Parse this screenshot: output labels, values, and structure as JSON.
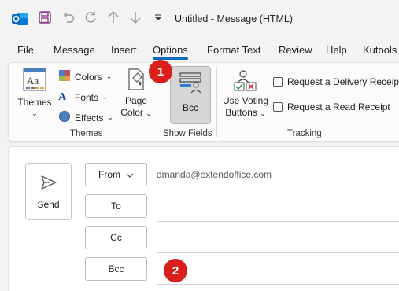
{
  "window": {
    "title": "Untitled  -  Message (HTML)"
  },
  "quick_access": [
    "outlook-app-icon",
    "save-icon",
    "undo-icon",
    "redo-icon",
    "arrow-up-icon",
    "arrow-down-icon",
    "customize-qat-icon"
  ],
  "tabs": [
    {
      "label": "File"
    },
    {
      "label": "Message"
    },
    {
      "label": "Insert"
    },
    {
      "label": "Options",
      "active": true
    },
    {
      "label": "Format Text"
    },
    {
      "label": "Review"
    },
    {
      "label": "Help"
    },
    {
      "label": "Kutools"
    }
  ],
  "ribbon": {
    "themes_group": {
      "label": "Themes",
      "themes_button": "Themes",
      "colors": "Colors",
      "fonts": "Fonts",
      "effects": "Effects",
      "page_color_line1": "Page",
      "page_color_line2": "Color"
    },
    "show_fields_group": {
      "label": "Show Fields",
      "bcc_button": "Bcc"
    },
    "tracking_group": {
      "label": "Tracking",
      "voting_line1": "Use Voting",
      "voting_line2": "Buttons",
      "delivery_receipt": "Request a Delivery Receipt",
      "read_receipt": "Request a Read Receipt"
    }
  },
  "annotations": {
    "badge1": "1",
    "badge2": "2",
    "badge_color": "#d9201c"
  },
  "compose": {
    "send_label": "Send",
    "from_label": "From",
    "from_value": "amanda@extendoffice.com",
    "to_label": "To",
    "cc_label": "Cc",
    "bcc_label": "Bcc"
  },
  "colors": {
    "accent": "#0f6cbd",
    "outlook_blue": "#0f6cbd",
    "save_purple": "#8a3f8f"
  }
}
